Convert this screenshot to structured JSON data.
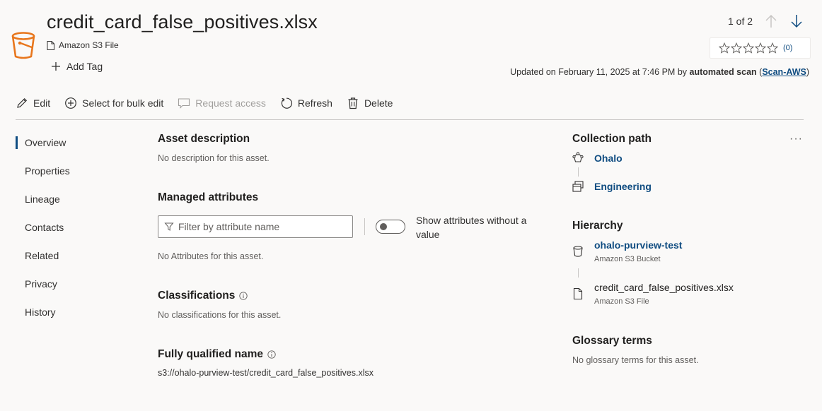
{
  "header": {
    "title": "credit_card_false_positives.xlsx",
    "asset_type": "Amazon S3 File",
    "add_tag_label": "Add Tag",
    "pager_text": "1 of 2",
    "rating_count": "(0)",
    "updated_prefix": "Updated on February 11, 2025 at 7:46 PM by ",
    "updated_by": "automated scan",
    "updated_open_paren": " (",
    "updated_source": "Scan-AWS",
    "updated_close_paren": ")"
  },
  "toolbar": {
    "edit_label": "Edit",
    "bulk_edit_label": "Select for bulk edit",
    "request_access_label": "Request access",
    "refresh_label": "Refresh",
    "delete_label": "Delete"
  },
  "nav": {
    "items": [
      {
        "label": "Overview",
        "active": true
      },
      {
        "label": "Properties"
      },
      {
        "label": "Lineage"
      },
      {
        "label": "Contacts"
      },
      {
        "label": "Related"
      },
      {
        "label": "Privacy"
      },
      {
        "label": "History"
      }
    ]
  },
  "main": {
    "description_title": "Asset description",
    "description_text": "No description for this asset.",
    "managed_title": "Managed attributes",
    "filter_placeholder": "Filter by attribute name",
    "toggle_label": "Show attributes without a value",
    "toggle_on": false,
    "no_attributes_text": "No Attributes for this asset.",
    "classifications_title": "Classifications",
    "classifications_text": "No classifications for this asset.",
    "fqn_title": "Fully qualified name",
    "fqn_value": "s3://ohalo-purview-test/credit_card_false_positives.xlsx"
  },
  "side": {
    "more_label": "···",
    "collection_title": "Collection path",
    "collections": [
      {
        "name": "Ohalo",
        "icon": "collection-root-icon"
      },
      {
        "name": "Engineering",
        "icon": "collection-icon"
      }
    ],
    "hierarchy_title": "Hierarchy",
    "hierarchy": [
      {
        "name": "ohalo-purview-test",
        "type": "Amazon S3 Bucket",
        "icon": "bucket-icon"
      },
      {
        "name": "credit_card_false_positives.xlsx",
        "type": "Amazon S3 File",
        "icon": "file-icon"
      }
    ],
    "glossary_title": "Glossary terms",
    "glossary_text": "No glossary terms for this asset."
  },
  "colors": {
    "accent": "#0f4c81",
    "bucket_orange": "#e8761c",
    "background": "#faf9f8"
  }
}
